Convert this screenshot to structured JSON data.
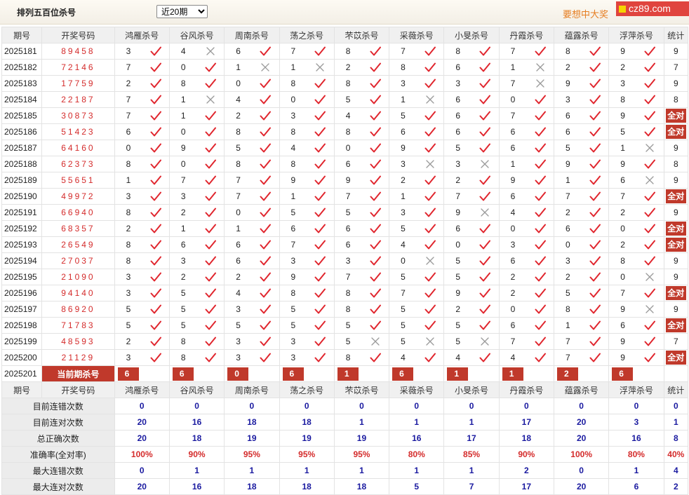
{
  "header": {
    "title": "排列五百位杀号",
    "period_selected": "近20期",
    "period_options": [
      "近20期"
    ],
    "promo": "要想中大奖",
    "brand": "cz89.com"
  },
  "table": {
    "col_issue": "期号",
    "col_numbers": "开奖号码",
    "experts": [
      "鸿雁杀号",
      "谷风杀号",
      "周南杀号",
      "荡之杀号",
      "芣苡杀号",
      "采薇杀号",
      "小旻杀号",
      "丹霞杀号",
      "蕴露杀号",
      "浮萍杀号"
    ],
    "col_count": "统计",
    "all_right_label": "全对",
    "rows": [
      {
        "issue": "2025181",
        "numbers": "89458",
        "kills": [
          3,
          4,
          6,
          7,
          8,
          7,
          8,
          7,
          8,
          9
        ],
        "ok": [
          1,
          0,
          1,
          1,
          1,
          1,
          1,
          1,
          1,
          1
        ],
        "count": "9"
      },
      {
        "issue": "2025182",
        "numbers": "72146",
        "kills": [
          7,
          0,
          1,
          1,
          2,
          8,
          6,
          1,
          2,
          2
        ],
        "ok": [
          1,
          1,
          0,
          0,
          1,
          1,
          1,
          0,
          1,
          1
        ],
        "count": "7"
      },
      {
        "issue": "2025183",
        "numbers": "17759",
        "kills": [
          2,
          8,
          0,
          8,
          8,
          3,
          3,
          7,
          9,
          3
        ],
        "ok": [
          1,
          1,
          1,
          1,
          1,
          1,
          1,
          0,
          1,
          1
        ],
        "count": "9"
      },
      {
        "issue": "2025184",
        "numbers": "22187",
        "kills": [
          7,
          1,
          4,
          0,
          5,
          1,
          6,
          0,
          3,
          8
        ],
        "ok": [
          1,
          0,
          1,
          1,
          1,
          0,
          1,
          1,
          1,
          1
        ],
        "count": "8"
      },
      {
        "issue": "2025185",
        "numbers": "30873",
        "kills": [
          7,
          1,
          2,
          3,
          4,
          5,
          6,
          7,
          6,
          9
        ],
        "ok": [
          1,
          1,
          1,
          1,
          1,
          1,
          1,
          1,
          1,
          1
        ],
        "count": "全对"
      },
      {
        "issue": "2025186",
        "numbers": "51423",
        "kills": [
          6,
          0,
          8,
          8,
          8,
          6,
          6,
          6,
          6,
          5
        ],
        "ok": [
          1,
          1,
          1,
          1,
          1,
          1,
          1,
          1,
          1,
          1
        ],
        "count": "全对"
      },
      {
        "issue": "2025187",
        "numbers": "64160",
        "kills": [
          0,
          9,
          5,
          4,
          0,
          9,
          5,
          6,
          5,
          1
        ],
        "ok": [
          1,
          1,
          1,
          1,
          1,
          1,
          1,
          1,
          1,
          0
        ],
        "count": "9"
      },
      {
        "issue": "2025188",
        "numbers": "62373",
        "kills": [
          8,
          0,
          8,
          8,
          6,
          3,
          3,
          1,
          9,
          9
        ],
        "ok": [
          1,
          1,
          1,
          1,
          1,
          0,
          0,
          1,
          1,
          1
        ],
        "count": "8"
      },
      {
        "issue": "2025189",
        "numbers": "55651",
        "kills": [
          1,
          7,
          7,
          9,
          9,
          2,
          2,
          9,
          1,
          6
        ],
        "ok": [
          1,
          1,
          1,
          1,
          1,
          1,
          1,
          1,
          1,
          0
        ],
        "count": "9"
      },
      {
        "issue": "2025190",
        "numbers": "49972",
        "kills": [
          3,
          3,
          7,
          1,
          7,
          1,
          7,
          6,
          7,
          7
        ],
        "ok": [
          1,
          1,
          1,
          1,
          1,
          1,
          1,
          1,
          1,
          1
        ],
        "count": "全对"
      },
      {
        "issue": "2025191",
        "numbers": "66940",
        "kills": [
          8,
          2,
          0,
          5,
          5,
          3,
          9,
          4,
          2,
          2
        ],
        "ok": [
          1,
          1,
          1,
          1,
          1,
          1,
          0,
          1,
          1,
          1
        ],
        "count": "9"
      },
      {
        "issue": "2025192",
        "numbers": "68357",
        "kills": [
          2,
          1,
          1,
          6,
          6,
          5,
          6,
          0,
          6,
          0
        ],
        "ok": [
          1,
          1,
          1,
          1,
          1,
          1,
          1,
          1,
          1,
          1
        ],
        "count": "全对"
      },
      {
        "issue": "2025193",
        "numbers": "26549",
        "kills": [
          8,
          6,
          6,
          7,
          6,
          4,
          0,
          3,
          0,
          2
        ],
        "ok": [
          1,
          1,
          1,
          1,
          1,
          1,
          1,
          1,
          1,
          1
        ],
        "count": "全对"
      },
      {
        "issue": "2025194",
        "numbers": "27037",
        "kills": [
          8,
          3,
          6,
          3,
          3,
          0,
          5,
          6,
          3,
          8
        ],
        "ok": [
          1,
          1,
          1,
          1,
          1,
          0,
          1,
          1,
          1,
          1
        ],
        "count": "9"
      },
      {
        "issue": "2025195",
        "numbers": "21090",
        "kills": [
          3,
          2,
          2,
          9,
          7,
          5,
          5,
          2,
          2,
          0
        ],
        "ok": [
          1,
          1,
          1,
          1,
          1,
          1,
          1,
          1,
          1,
          0
        ],
        "count": "9"
      },
      {
        "issue": "2025196",
        "numbers": "94140",
        "kills": [
          3,
          5,
          4,
          8,
          8,
          7,
          9,
          2,
          5,
          7
        ],
        "ok": [
          1,
          1,
          1,
          1,
          1,
          1,
          1,
          1,
          1,
          1
        ],
        "count": "全对"
      },
      {
        "issue": "2025197",
        "numbers": "86920",
        "kills": [
          5,
          5,
          3,
          5,
          8,
          5,
          2,
          0,
          8,
          9
        ],
        "ok": [
          1,
          1,
          1,
          1,
          1,
          1,
          1,
          1,
          1,
          0
        ],
        "count": "9"
      },
      {
        "issue": "2025198",
        "numbers": "71783",
        "kills": [
          5,
          5,
          5,
          5,
          5,
          5,
          5,
          6,
          1,
          6
        ],
        "ok": [
          1,
          1,
          1,
          1,
          1,
          1,
          1,
          1,
          1,
          1
        ],
        "count": "全对"
      },
      {
        "issue": "2025199",
        "numbers": "48593",
        "kills": [
          2,
          8,
          3,
          3,
          5,
          5,
          5,
          7,
          7,
          9
        ],
        "ok": [
          1,
          1,
          1,
          1,
          0,
          0,
          0,
          1,
          1,
          1
        ],
        "count": "7"
      },
      {
        "issue": "2025200",
        "numbers": "21129",
        "kills": [
          3,
          8,
          3,
          3,
          8,
          4,
          4,
          4,
          7,
          9
        ],
        "ok": [
          1,
          1,
          1,
          1,
          1,
          1,
          1,
          1,
          1,
          1
        ],
        "count": "全对"
      }
    ],
    "current": {
      "issue": "2025201",
      "label": "当前期杀号",
      "kills": [
        "6",
        "6",
        "0",
        "6",
        "1",
        "6",
        "1",
        "1",
        "2",
        "6"
      ]
    },
    "stats_labels": [
      "目前连错次数",
      "目前连对次数",
      "总正确次数",
      "准确率(全对率)",
      "最大连错次数",
      "最大连对次数"
    ],
    "stats": [
      [
        "0",
        "0",
        "0",
        "0",
        "0",
        "0",
        "0",
        "0",
        "0",
        "0",
        "0"
      ],
      [
        "20",
        "16",
        "18",
        "18",
        "1",
        "1",
        "1",
        "17",
        "20",
        "3",
        "1"
      ],
      [
        "20",
        "18",
        "19",
        "19",
        "19",
        "16",
        "17",
        "18",
        "20",
        "16",
        "8"
      ],
      [
        "100%",
        "90%",
        "95%",
        "95%",
        "95%",
        "80%",
        "85%",
        "90%",
        "100%",
        "80%",
        "40%"
      ],
      [
        "0",
        "1",
        "1",
        "1",
        "1",
        "1",
        "1",
        "2",
        "0",
        "1",
        "4"
      ],
      [
        "20",
        "16",
        "18",
        "18",
        "18",
        "5",
        "7",
        "17",
        "20",
        "6",
        "2"
      ]
    ]
  },
  "colors": {
    "accent_red": "#c0392b",
    "check_red": "#e0262e",
    "cross_gray": "#9a9a9a",
    "stat_blue": "#1a1aa0",
    "promo_orange": "#e67e22"
  }
}
